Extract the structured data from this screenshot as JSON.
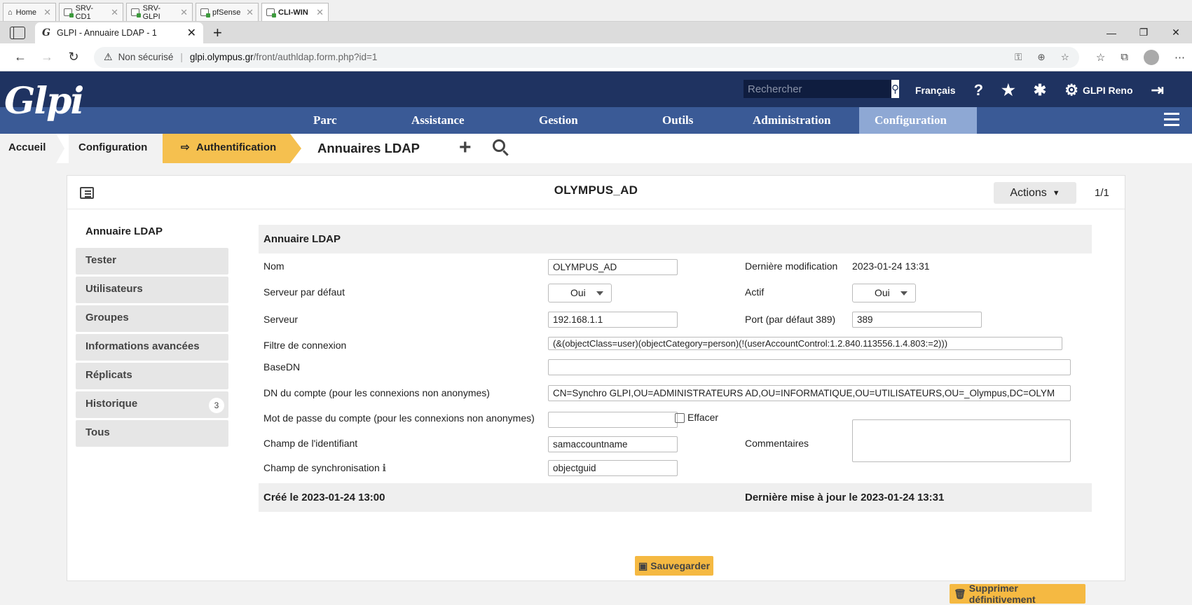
{
  "vm_tabs": [
    "Home",
    "SRV-CD1",
    "SRV-GLPI",
    "pfSense",
    "CLI-WIN"
  ],
  "browser": {
    "tab_title": "GLPI - Annuaire LDAP - 1",
    "security": "Non sécurisé",
    "url_host": "glpi.olympus.gr",
    "url_path": "/front/authldap.form.php?id=1"
  },
  "header": {
    "logo": "Glpi",
    "search_placeholder": "Rechercher",
    "language": "Français",
    "user": "GLPI Reno"
  },
  "menu": [
    "Parc",
    "Assistance",
    "Gestion",
    "Outils",
    "Administration",
    "Configuration"
  ],
  "breadcrumb": [
    "Accueil",
    "Configuration",
    "Authentification"
  ],
  "page_title": "Annuaires LDAP",
  "card": {
    "title": "OLYMPUS_AD",
    "actions": "Actions",
    "pager": "1/1"
  },
  "side_tabs": [
    {
      "label": "Annuaire LDAP"
    },
    {
      "label": "Tester"
    },
    {
      "label": "Utilisateurs"
    },
    {
      "label": "Groupes"
    },
    {
      "label": "Informations avancées"
    },
    {
      "label": "Réplicats"
    },
    {
      "label": "Historique",
      "badge": "3"
    },
    {
      "label": "Tous"
    }
  ],
  "form": {
    "header": "Annuaire LDAP",
    "nom_label": "Nom",
    "nom_value": "OLYMPUS_AD",
    "derniere_modif_label": "Dernière modification",
    "derniere_modif_value": "2023-01-24 13:31",
    "serveur_defaut_label": "Serveur par défaut",
    "serveur_defaut_value": "Oui",
    "actif_label": "Actif",
    "actif_value": "Oui",
    "serveur_label": "Serveur",
    "serveur_value": "192.168.1.1",
    "port_label": "Port (par défaut 389)",
    "port_value": "389",
    "filtre_label": "Filtre de connexion",
    "filtre_value": "(&(objectClass=user)(objectCategory=person)(!(userAccountControl:1.2.840.113556.1.4.803:=2)))",
    "basedn_label": "BaseDN",
    "basedn_value": "",
    "dn_label": "DN du compte (pour les connexions non anonymes)",
    "dn_value": "CN=Synchro GLPI,OU=ADMINISTRATEURS AD,OU=INFORMATIQUE,OU=UTILISATEURS,OU=_Olympus,DC=OLYM",
    "mdp_label": "Mot de passe du compte (pour les connexions non anonymes)",
    "mdp_value": "",
    "effacer_label": "Effacer",
    "identifiant_label": "Champ de l'identifiant",
    "identifiant_value": "samaccountname",
    "commentaires_label": "Commentaires",
    "sync_label": "Champ de synchronisation",
    "sync_value": "objectguid",
    "cree": "Créé le 2023-01-24 13:00",
    "maj": "Dernière mise à jour le 2023-01-24 13:31",
    "save_label": "Sauvegarder",
    "delete_label": "Supprimer définitivement"
  }
}
